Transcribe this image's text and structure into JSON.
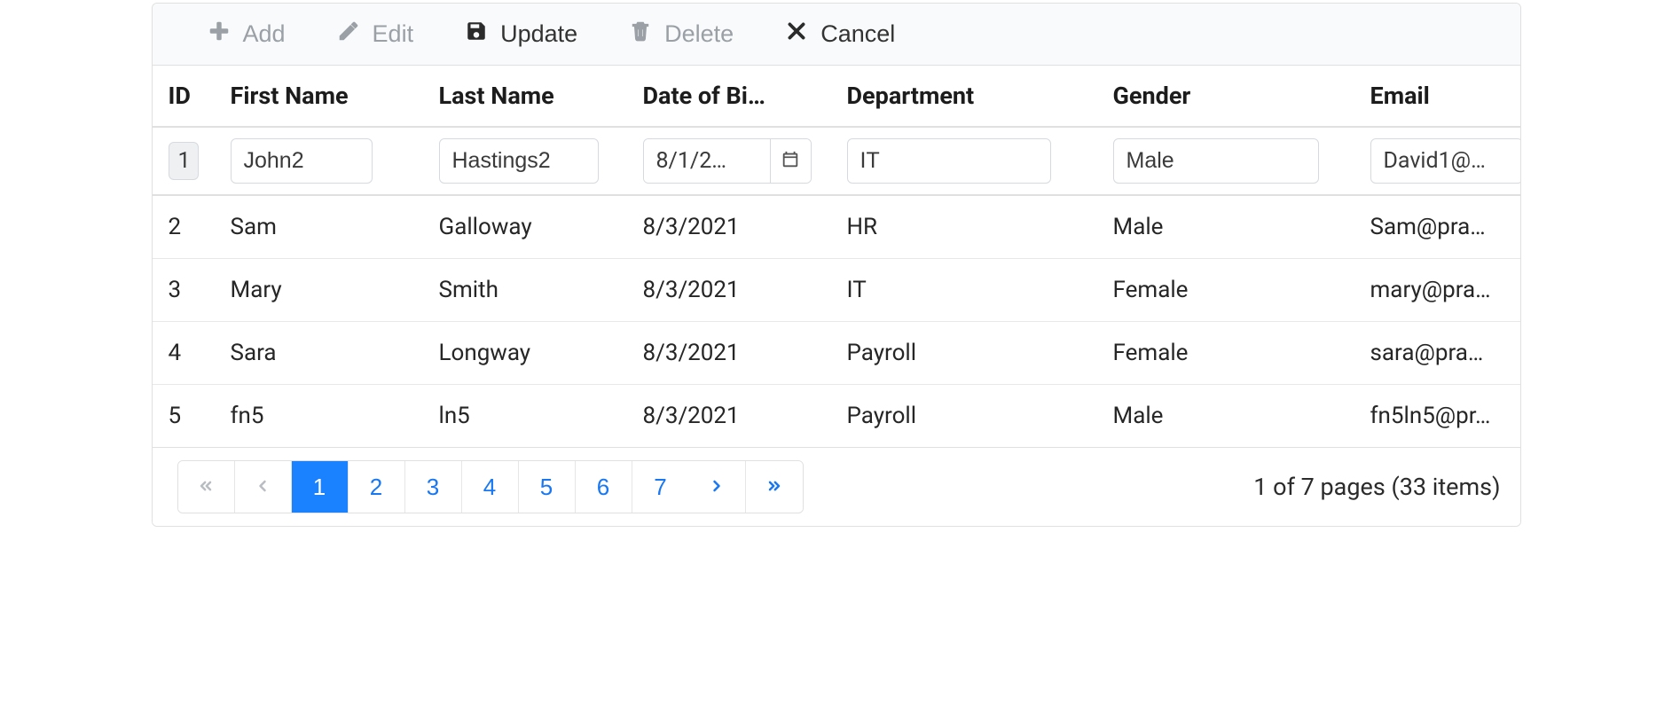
{
  "toolbar": {
    "add": {
      "label": "Add",
      "enabled": false
    },
    "edit": {
      "label": "Edit",
      "enabled": false
    },
    "update": {
      "label": "Update",
      "enabled": true
    },
    "delete": {
      "label": "Delete",
      "enabled": false
    },
    "cancel": {
      "label": "Cancel",
      "enabled": true
    }
  },
  "columns": {
    "id": "ID",
    "first": "First Name",
    "last": "Last Name",
    "dob": "Date of Bi…",
    "dept": "Department",
    "gender": "Gender",
    "email": "Email"
  },
  "editRow": {
    "id": "1",
    "first": "John2",
    "last": "Hastings2",
    "dob_display": "8/1/2…",
    "dept": "IT",
    "gender": "Male",
    "email_display": "David1@…"
  },
  "rows": [
    {
      "id": "2",
      "first": "Sam",
      "last": "Galloway",
      "dob": "8/3/2021",
      "dept": "HR",
      "gender": "Male",
      "email": "Sam@pra…"
    },
    {
      "id": "3",
      "first": "Mary",
      "last": "Smith",
      "dob": "8/3/2021",
      "dept": "IT",
      "gender": "Female",
      "email": "mary@pra…"
    },
    {
      "id": "4",
      "first": "Sara",
      "last": "Longway",
      "dob": "8/3/2021",
      "dept": "Payroll",
      "gender": "Female",
      "email": "sara@pra…"
    },
    {
      "id": "5",
      "first": "fn5",
      "last": "ln5",
      "dob": "8/3/2021",
      "dept": "Payroll",
      "gender": "Male",
      "email": "fn5ln5@pr…"
    }
  ],
  "pager": {
    "pages": [
      "1",
      "2",
      "3",
      "4",
      "5",
      "6",
      "7"
    ],
    "current": "1",
    "info": "1 of 7 pages (33 items)"
  }
}
